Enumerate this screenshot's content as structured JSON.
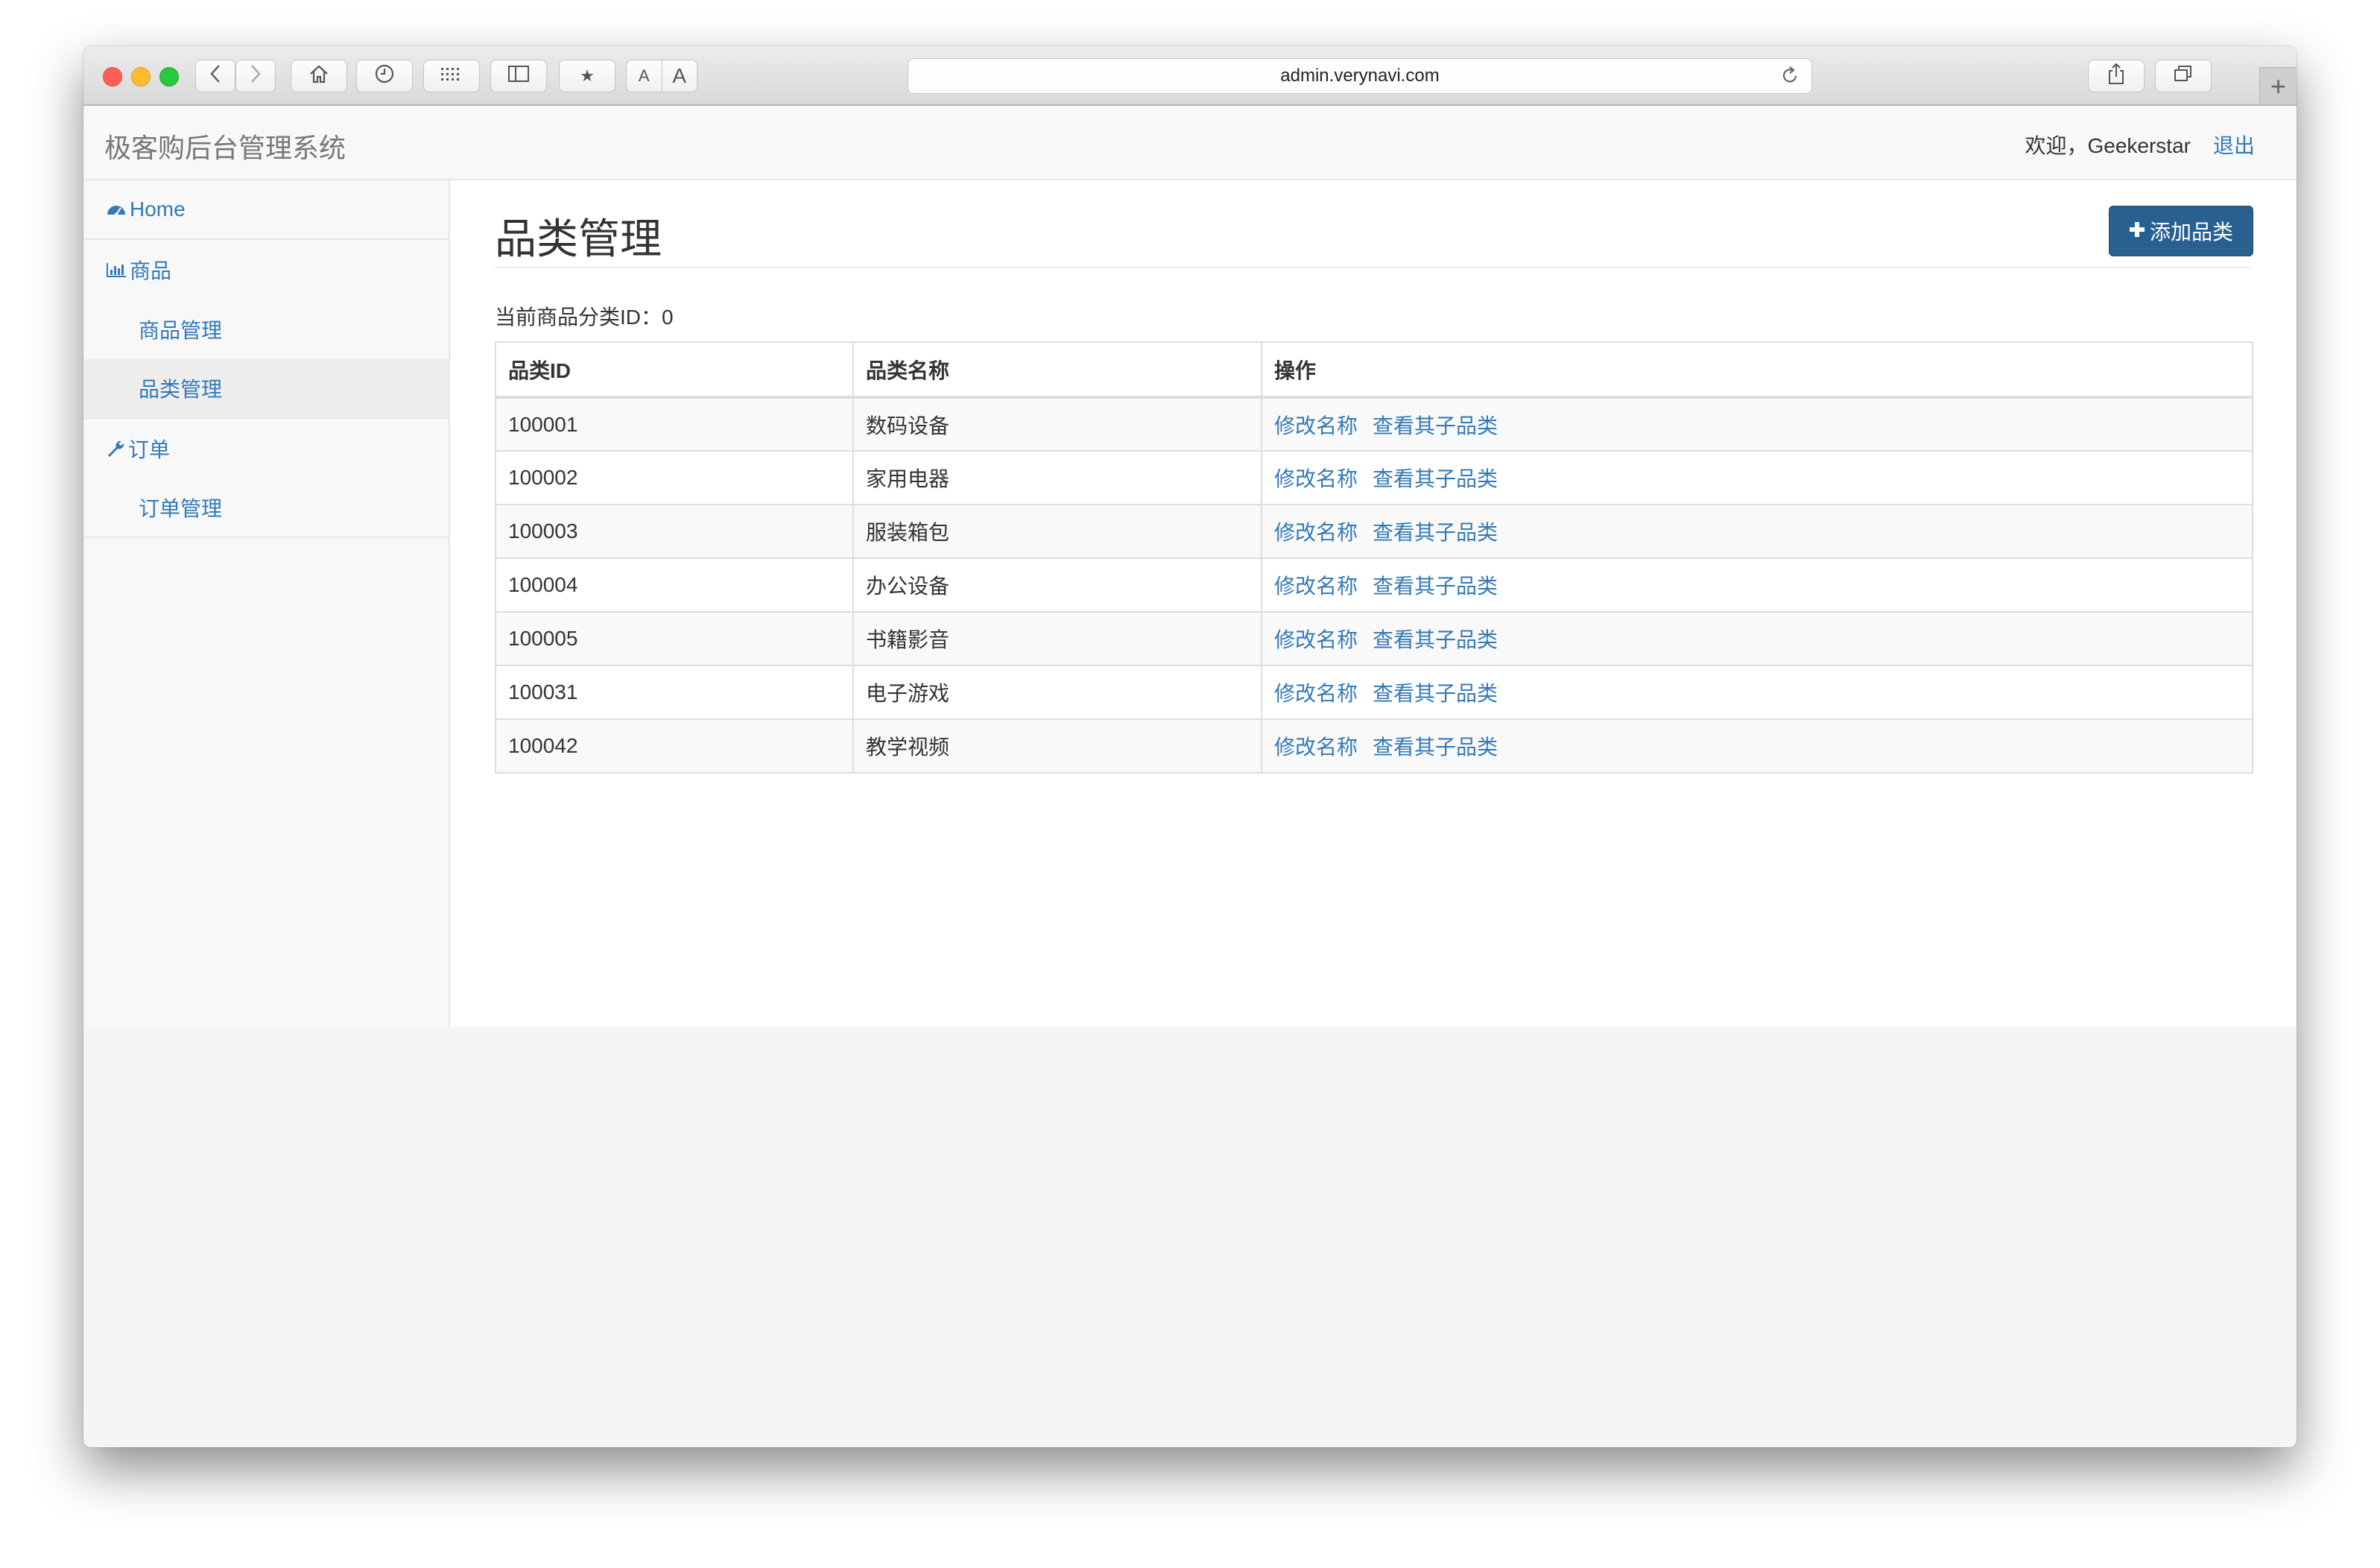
{
  "browser": {
    "url": "admin.verynavi.com",
    "font_small": "A",
    "font_large": "A"
  },
  "navbar": {
    "brand": "极客购后台管理系统",
    "welcome": "欢迎，Geekerstar",
    "logout": "退出"
  },
  "sidebar": {
    "home": "Home",
    "product_group": "商品",
    "product_manage": "商品管理",
    "category_manage": "品类管理",
    "order_group": "订单",
    "order_manage": "订单管理"
  },
  "main": {
    "title": "品类管理",
    "add_button": "添加品类",
    "current_id_label": "当前商品分类ID：0",
    "columns": [
      "品类ID",
      "品类名称",
      "操作"
    ],
    "rename_action": "修改名称",
    "children_action": "查看其子品类",
    "rows": [
      {
        "id": "100001",
        "name": "数码设备",
        "edit": "修改名称",
        "children": "查看其子品类"
      },
      {
        "id": "100002",
        "name": "家用电器",
        "edit": "修改名称",
        "children": "查看其子品类"
      },
      {
        "id": "100003",
        "name": "服装箱包",
        "edit": "修改名称",
        "children": "查看其子品类"
      },
      {
        "id": "100004",
        "name": "办公设备",
        "edit": "修改名称",
        "children": "查看其子品类"
      },
      {
        "id": "100005",
        "name": "书籍影音",
        "edit": "修改名称",
        "children": "查看其子品类"
      },
      {
        "id": "100031",
        "name": "电子游戏",
        "edit": "修改名称",
        "children": "查看其子品类"
      },
      {
        "id": "100042",
        "name": "教学视频",
        "edit": "修改名称",
        "children": "查看其子品类"
      }
    ]
  },
  "colors": {
    "link": "#337ab7",
    "primary_button": "#286090",
    "navbar_bg": "#f8f8f8",
    "stripe": "#f9f9f9"
  }
}
